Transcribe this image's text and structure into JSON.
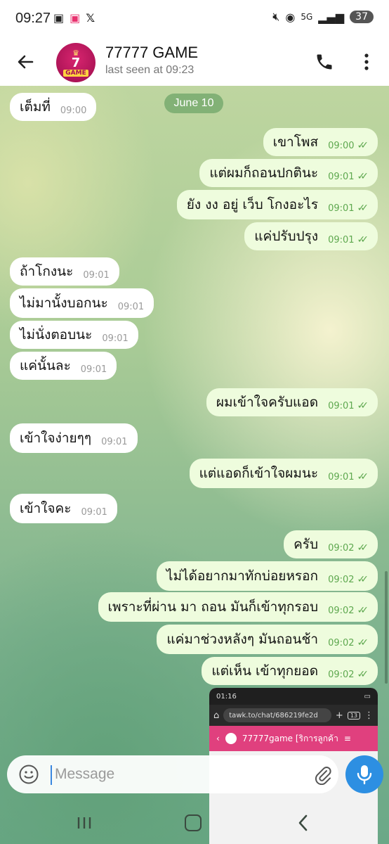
{
  "status_bar": {
    "time": "09:27",
    "left_icons": [
      "screenshot-icon",
      "app-badge-icon",
      "x-icon"
    ],
    "right_icons": [
      "mute-icon",
      "hotspot-icon",
      "5g-icon",
      "signal-icon"
    ],
    "battery": "37"
  },
  "header": {
    "back_icon": "arrow-left-icon",
    "avatar": {
      "top": "7",
      "bottom": "GAME"
    },
    "title": "77777 GAME",
    "subtitle": "last seen at 09:23",
    "call_icon": "phone-icon",
    "menu_icon": "more-vertical-icon"
  },
  "chat": {
    "date_separator": "June 10",
    "messages": [
      {
        "dir": "in",
        "text": "เต็มที่",
        "time": "09:00"
      },
      {
        "dir": "out",
        "text": "เขาโพส",
        "time": "09:00"
      },
      {
        "dir": "out",
        "text": "แต่ผมก็ถอนปกตินะ",
        "time": "09:01"
      },
      {
        "dir": "out",
        "text": "ยัง งง อยู่ เว็บ โกงอะไร",
        "time": "09:01"
      },
      {
        "dir": "out",
        "text": "แค่ปรับปรุง",
        "time": "09:01"
      },
      {
        "dir": "in",
        "text": "ถ้าโกงนะ",
        "time": "09:01"
      },
      {
        "dir": "in",
        "text": "ไม่มานั้งบอกนะ",
        "time": "09:01"
      },
      {
        "dir": "in",
        "text": "ไม่นั่งตอบนะ",
        "time": "09:01"
      },
      {
        "dir": "in",
        "text": "แค่นั้นละ",
        "time": "09:01"
      },
      {
        "dir": "out",
        "text": "ผมเข้าใจครับแอด",
        "time": "09:01"
      },
      {
        "dir": "in",
        "text": "เข้าใจง่ายๆๆ",
        "time": "09:01"
      },
      {
        "dir": "out",
        "text": "แต่แอดก็เข้าใจผมนะ",
        "time": "09:01"
      },
      {
        "dir": "in",
        "text": "เข้าใจคะ",
        "time": "09:01"
      },
      {
        "dir": "out",
        "text": "ครับ",
        "time": "09:02"
      },
      {
        "dir": "out",
        "text": "ไม่ได้อยากมาทักบ่อยหรอก",
        "time": "09:02"
      },
      {
        "dir": "out",
        "text": "เพราะที่ผ่าน มา ถอน มันก็เข้าทุกรอบ",
        "time": "09:02"
      },
      {
        "dir": "out",
        "text": "แค่มาช่วงหลังๆ มันถอนช้า",
        "time": "09:02"
      },
      {
        "dir": "out",
        "text": "แต่เห็น เข้าทุกยอด",
        "time": "09:02"
      }
    ],
    "image_preview": {
      "time": "01:16",
      "url": "tawk.to/chat/686219fe2d",
      "tab_count": "13",
      "chat_title": "77777game [ริการลูกค้า"
    }
  },
  "composer": {
    "placeholder": "Message",
    "emoji_icon": "emoji-icon",
    "attach_icon": "paperclip-icon",
    "mic_icon": "microphone-icon"
  },
  "nav": [
    "recents-icon",
    "home-icon",
    "back-icon"
  ],
  "colors": {
    "outgoing": "#eefcdd",
    "incoming": "#ffffff",
    "accent": "#2d8fe2",
    "check": "#5ea84f"
  }
}
